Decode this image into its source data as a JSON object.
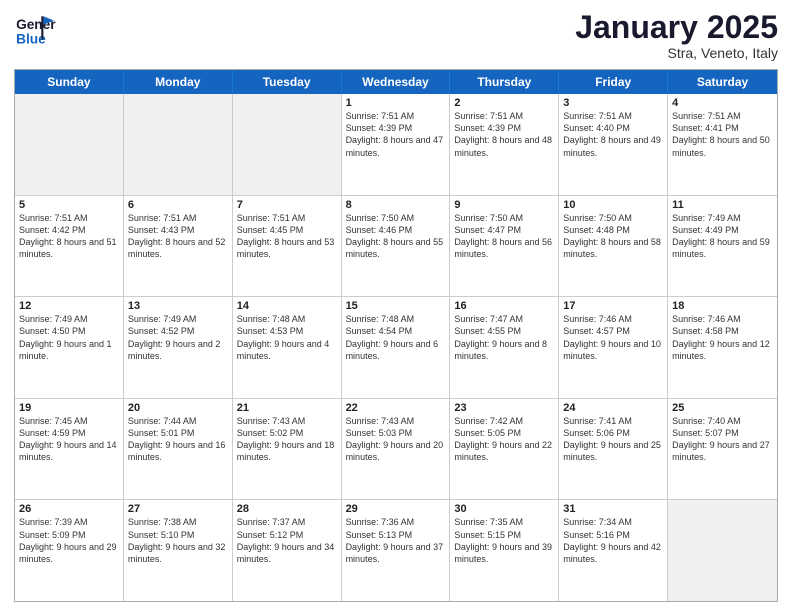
{
  "header": {
    "logo_general": "General",
    "logo_blue": "Blue",
    "month_title": "January 2025",
    "location": "Stra, Veneto, Italy"
  },
  "weekdays": [
    "Sunday",
    "Monday",
    "Tuesday",
    "Wednesday",
    "Thursday",
    "Friday",
    "Saturday"
  ],
  "rows": [
    [
      {
        "day": "",
        "info": "",
        "shaded": true
      },
      {
        "day": "",
        "info": "",
        "shaded": true
      },
      {
        "day": "",
        "info": "",
        "shaded": true
      },
      {
        "day": "1",
        "info": "Sunrise: 7:51 AM\nSunset: 4:39 PM\nDaylight: 8 hours and 47 minutes."
      },
      {
        "day": "2",
        "info": "Sunrise: 7:51 AM\nSunset: 4:39 PM\nDaylight: 8 hours and 48 minutes."
      },
      {
        "day": "3",
        "info": "Sunrise: 7:51 AM\nSunset: 4:40 PM\nDaylight: 8 hours and 49 minutes."
      },
      {
        "day": "4",
        "info": "Sunrise: 7:51 AM\nSunset: 4:41 PM\nDaylight: 8 hours and 50 minutes."
      }
    ],
    [
      {
        "day": "5",
        "info": "Sunrise: 7:51 AM\nSunset: 4:42 PM\nDaylight: 8 hours and 51 minutes."
      },
      {
        "day": "6",
        "info": "Sunrise: 7:51 AM\nSunset: 4:43 PM\nDaylight: 8 hours and 52 minutes."
      },
      {
        "day": "7",
        "info": "Sunrise: 7:51 AM\nSunset: 4:45 PM\nDaylight: 8 hours and 53 minutes."
      },
      {
        "day": "8",
        "info": "Sunrise: 7:50 AM\nSunset: 4:46 PM\nDaylight: 8 hours and 55 minutes."
      },
      {
        "day": "9",
        "info": "Sunrise: 7:50 AM\nSunset: 4:47 PM\nDaylight: 8 hours and 56 minutes."
      },
      {
        "day": "10",
        "info": "Sunrise: 7:50 AM\nSunset: 4:48 PM\nDaylight: 8 hours and 58 minutes."
      },
      {
        "day": "11",
        "info": "Sunrise: 7:49 AM\nSunset: 4:49 PM\nDaylight: 8 hours and 59 minutes."
      }
    ],
    [
      {
        "day": "12",
        "info": "Sunrise: 7:49 AM\nSunset: 4:50 PM\nDaylight: 9 hours and 1 minute."
      },
      {
        "day": "13",
        "info": "Sunrise: 7:49 AM\nSunset: 4:52 PM\nDaylight: 9 hours and 2 minutes."
      },
      {
        "day": "14",
        "info": "Sunrise: 7:48 AM\nSunset: 4:53 PM\nDaylight: 9 hours and 4 minutes."
      },
      {
        "day": "15",
        "info": "Sunrise: 7:48 AM\nSunset: 4:54 PM\nDaylight: 9 hours and 6 minutes."
      },
      {
        "day": "16",
        "info": "Sunrise: 7:47 AM\nSunset: 4:55 PM\nDaylight: 9 hours and 8 minutes."
      },
      {
        "day": "17",
        "info": "Sunrise: 7:46 AM\nSunset: 4:57 PM\nDaylight: 9 hours and 10 minutes."
      },
      {
        "day": "18",
        "info": "Sunrise: 7:46 AM\nSunset: 4:58 PM\nDaylight: 9 hours and 12 minutes."
      }
    ],
    [
      {
        "day": "19",
        "info": "Sunrise: 7:45 AM\nSunset: 4:59 PM\nDaylight: 9 hours and 14 minutes."
      },
      {
        "day": "20",
        "info": "Sunrise: 7:44 AM\nSunset: 5:01 PM\nDaylight: 9 hours and 16 minutes."
      },
      {
        "day": "21",
        "info": "Sunrise: 7:43 AM\nSunset: 5:02 PM\nDaylight: 9 hours and 18 minutes."
      },
      {
        "day": "22",
        "info": "Sunrise: 7:43 AM\nSunset: 5:03 PM\nDaylight: 9 hours and 20 minutes."
      },
      {
        "day": "23",
        "info": "Sunrise: 7:42 AM\nSunset: 5:05 PM\nDaylight: 9 hours and 22 minutes."
      },
      {
        "day": "24",
        "info": "Sunrise: 7:41 AM\nSunset: 5:06 PM\nDaylight: 9 hours and 25 minutes."
      },
      {
        "day": "25",
        "info": "Sunrise: 7:40 AM\nSunset: 5:07 PM\nDaylight: 9 hours and 27 minutes."
      }
    ],
    [
      {
        "day": "26",
        "info": "Sunrise: 7:39 AM\nSunset: 5:09 PM\nDaylight: 9 hours and 29 minutes."
      },
      {
        "day": "27",
        "info": "Sunrise: 7:38 AM\nSunset: 5:10 PM\nDaylight: 9 hours and 32 minutes."
      },
      {
        "day": "28",
        "info": "Sunrise: 7:37 AM\nSunset: 5:12 PM\nDaylight: 9 hours and 34 minutes."
      },
      {
        "day": "29",
        "info": "Sunrise: 7:36 AM\nSunset: 5:13 PM\nDaylight: 9 hours and 37 minutes."
      },
      {
        "day": "30",
        "info": "Sunrise: 7:35 AM\nSunset: 5:15 PM\nDaylight: 9 hours and 39 minutes."
      },
      {
        "day": "31",
        "info": "Sunrise: 7:34 AM\nSunset: 5:16 PM\nDaylight: 9 hours and 42 minutes."
      },
      {
        "day": "",
        "info": "",
        "shaded": true
      }
    ]
  ]
}
